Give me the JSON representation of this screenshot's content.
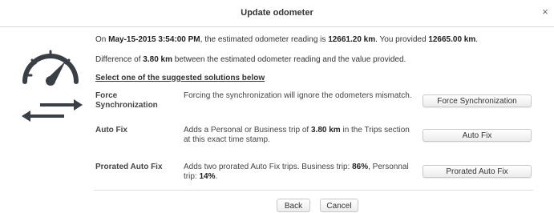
{
  "window": {
    "title": "Update odometer",
    "close_label": "×"
  },
  "icon": {
    "name": "odometer-sync-icon"
  },
  "summary": {
    "on": "On",
    "date": "May-15-2015 3:54:00 PM",
    "mid": ", the estimated odometer reading is",
    "estimated": "12661.20 km",
    "provided_text": ". You provided",
    "provided": "12665.00 km",
    "end": "."
  },
  "difference": {
    "pre": "Difference of",
    "value": "3.80 km",
    "post": "between the estimated odometer reading and the value provided."
  },
  "solutions_heading": "Select one of the suggested solutions below",
  "solutions": [
    {
      "label": "Force Synchronization",
      "description": "Forcing the synchronization will ignore the odometers mismatch.",
      "button": "Force Synchronization"
    },
    {
      "label": "Auto Fix",
      "desc_pre": "Adds a Personal or Business trip of",
      "desc_value": "3.80 km",
      "desc_post": "in the Trips section at this exact time stamp.",
      "button": "Auto Fix"
    },
    {
      "label": "Prorated Auto Fix",
      "desc_pre": "Adds two prorated Auto Fix trips. Business trip:",
      "business_pct": "86%",
      "desc_mid": ", Personnal trip:",
      "personal_pct": "14%",
      "desc_end": ".",
      "button": "Prorated Auto Fix"
    }
  ],
  "footer": {
    "back": "Back",
    "cancel": "Cancel"
  },
  "colors": {
    "text": "#333333",
    "border": "#c8c8c8",
    "icon": "#3a3f45"
  }
}
